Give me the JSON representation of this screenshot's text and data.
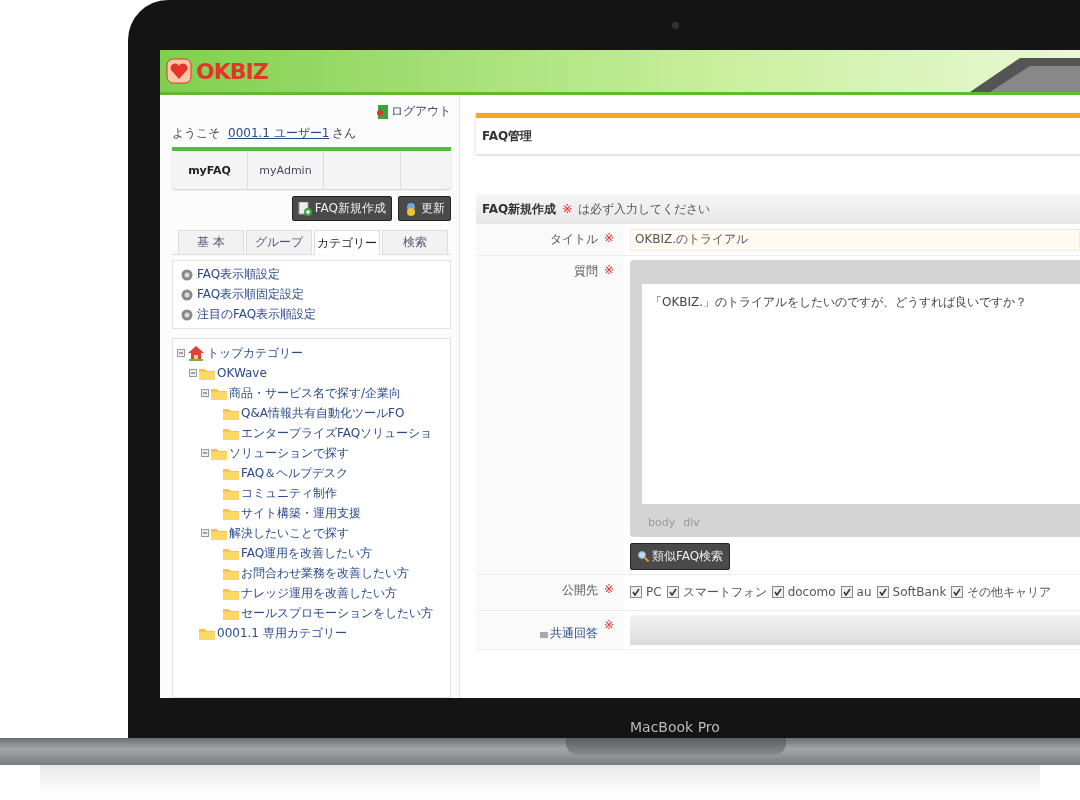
{
  "device": {
    "label": "MacBook Pro"
  },
  "app": {
    "logo": "OKBIZ"
  },
  "sidebar": {
    "logout": "ログアウト",
    "welcome": "ようこそ",
    "user": "0001.1 ユーザー1",
    "honorific": "さん",
    "top_tabs": [
      {
        "label": "myFAQ",
        "selected": true
      },
      {
        "label": "myAdmin",
        "selected": false
      }
    ],
    "buttons": [
      {
        "label": "FAQ新規作成",
        "kind": "new"
      },
      {
        "label": "更新",
        "kind": "refresh"
      }
    ],
    "tabs": [
      {
        "label": "基 本",
        "selected": false
      },
      {
        "label": "グループ",
        "selected": false
      },
      {
        "label": "カテゴリー",
        "selected": true
      },
      {
        "label": "検索",
        "selected": false
      }
    ],
    "settings": [
      "FAQ表示順設定",
      "FAQ表示順固定設定",
      "注目のFAQ表示順設定"
    ],
    "tree": [
      {
        "label": "トップカテゴリー",
        "kind": "home",
        "expanded": true,
        "children": [
          {
            "label": "OKWave",
            "kind": "folder",
            "expanded": true,
            "children": [
              {
                "label": "商品・サービス名で探す/企業向",
                "kind": "folder",
                "expanded": true,
                "children": [
                  {
                    "label": "Q&A情報共有自動化ツールFO",
                    "kind": "folder"
                  },
                  {
                    "label": "エンタープライズFAQソリューショ",
                    "kind": "folder"
                  }
                ]
              },
              {
                "label": "ソリューションで探す",
                "kind": "folder",
                "expanded": true,
                "children": [
                  {
                    "label": "FAQ＆ヘルプデスク",
                    "kind": "folder"
                  },
                  {
                    "label": "コミュニティ制作",
                    "kind": "folder"
                  },
                  {
                    "label": "サイト構築・運用支援",
                    "kind": "folder"
                  }
                ]
              },
              {
                "label": "解決したいことで探す",
                "kind": "folder",
                "expanded": true,
                "children": [
                  {
                    "label": "FAQ運用を改善したい方",
                    "kind": "folder"
                  },
                  {
                    "label": "お問合わせ業務を改善したい方",
                    "kind": "folder"
                  },
                  {
                    "label": "ナレッジ運用を改善したい方",
                    "kind": "folder"
                  },
                  {
                    "label": "セールスプロモーションをしたい方",
                    "kind": "folder"
                  }
                ]
              }
            ]
          },
          {
            "label": "0001.1 専用カテゴリー",
            "kind": "folder"
          }
        ]
      }
    ]
  },
  "main": {
    "page_title": "FAQ管理",
    "form_title": "FAQ新規作成",
    "required_mark": "※",
    "required_note": "は必ず入力してください",
    "title_field": {
      "label": "タイトル",
      "value": "OKBIZ.のトライアル"
    },
    "question_field": {
      "label": "質問",
      "value": "「OKBIZ.」のトライアルをしたいのですが、どうすれば良いですか？",
      "path": [
        "body",
        "div"
      ]
    },
    "similar_button": "類似FAQ検索",
    "publish": {
      "label": "公開先",
      "options": [
        {
          "label": "PC",
          "checked": true
        },
        {
          "label": "スマートフォン",
          "checked": true
        },
        {
          "label": "docomo",
          "checked": true
        },
        {
          "label": "au",
          "checked": true
        },
        {
          "label": "SoftBank",
          "checked": true
        },
        {
          "label": "その他キャリア",
          "checked": true
        }
      ]
    },
    "answer_field": {
      "label": "共通回答"
    }
  }
}
